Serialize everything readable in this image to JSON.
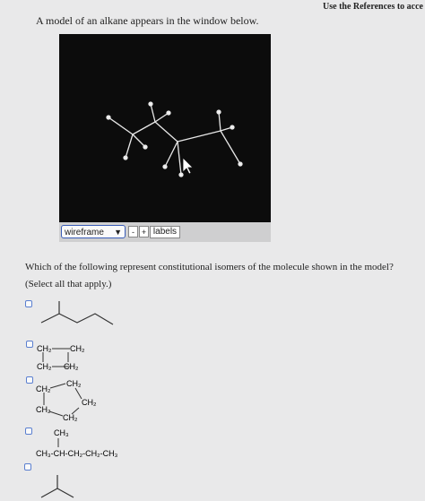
{
  "header": {
    "references_link": "Use the References to acce"
  },
  "intro_text": "A model of an alkane appears in the window below.",
  "viewer": {
    "display_mode": "wireframe",
    "zoom_out_label": "-",
    "zoom_in_label": "+",
    "labels_button": "labels"
  },
  "question": {
    "text": "Which of the following represent constitutional isomers of the molecule shown in the model?",
    "instruction": "(Select all that apply.)"
  },
  "options": {
    "opt2": {
      "tl": "CH₂",
      "tr": "CH₂",
      "bl": "CH₂",
      "br": "CH₂"
    },
    "opt3": {
      "top": "CH₂",
      "left": "CH₂",
      "right": "CH₂",
      "bottom_left": "CH₂",
      "bottom": "CH₂"
    },
    "opt4": {
      "branch": "CH₃",
      "chain": "CH₃-CH-CH₂-CH₂-CH₃"
    }
  }
}
